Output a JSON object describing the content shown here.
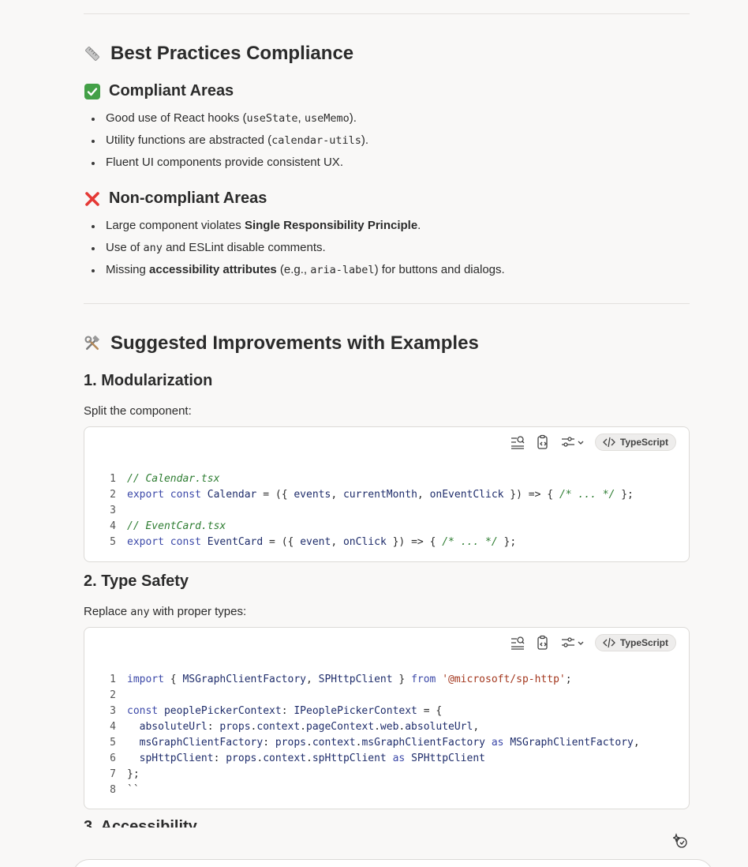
{
  "sections": {
    "best_practices": {
      "title": "Best Practices Compliance",
      "icon": "ruler-icon",
      "compliant": {
        "title": "Compliant Areas",
        "icon": "check-box-icon",
        "items": [
          {
            "pre": "Good use of React hooks (",
            "code1": "useState",
            "mid": ", ",
            "code2": "useMemo",
            "post": ")."
          },
          {
            "pre": "Utility functions are abstracted (",
            "code1": "calendar-utils",
            "post": ")."
          },
          {
            "text": "Fluent UI components provide consistent UX."
          }
        ]
      },
      "noncompliant": {
        "title": "Non-compliant Areas",
        "icon": "cross-mark-icon",
        "items": [
          {
            "pre": "Large component violates ",
            "bold": "Single Responsibility Principle",
            "post": "."
          },
          {
            "pre": "Use of ",
            "code1": "any",
            "post": " and ESLint disable comments."
          },
          {
            "pre": "Missing ",
            "bold": "accessibility attributes",
            "mid": " (e.g., ",
            "code1": "aria-label",
            "post": ") for buttons and dialogs."
          }
        ]
      }
    },
    "improvements": {
      "title": "Suggested Improvements with Examples",
      "icon": "hammer-wrench-icon",
      "sub1": {
        "title": "1. Modularization",
        "text": "Split the component:",
        "lang": "TypeScript",
        "lines": [
          {
            "n": "1",
            "tokens": [
              [
                "com",
                "// Calendar.tsx"
              ]
            ]
          },
          {
            "n": "2",
            "tokens": [
              [
                "kw",
                "export"
              ],
              [
                "p",
                " "
              ],
              [
                "kw",
                "const"
              ],
              [
                "p",
                " "
              ],
              [
                "id",
                "Calendar"
              ],
              [
                "p",
                " = ({ "
              ],
              [
                "id",
                "events"
              ],
              [
                "p",
                ", "
              ],
              [
                "id",
                "currentMonth"
              ],
              [
                "p",
                ", "
              ],
              [
                "id",
                "onEventClick"
              ],
              [
                "p",
                " }) => { "
              ],
              [
                "com",
                "/* ... */"
              ],
              [
                "p",
                " };"
              ]
            ]
          },
          {
            "n": "3",
            "tokens": []
          },
          {
            "n": "4",
            "tokens": [
              [
                "com",
                "// EventCard.tsx"
              ]
            ]
          },
          {
            "n": "5",
            "tokens": [
              [
                "kw",
                "export"
              ],
              [
                "p",
                " "
              ],
              [
                "kw",
                "const"
              ],
              [
                "p",
                " "
              ],
              [
                "id",
                "EventCard"
              ],
              [
                "p",
                " = ({ "
              ],
              [
                "id",
                "event"
              ],
              [
                "p",
                ", "
              ],
              [
                "id",
                "onClick"
              ],
              [
                "p",
                " }) => { "
              ],
              [
                "com",
                "/* ... */"
              ],
              [
                "p",
                " };"
              ]
            ]
          }
        ]
      },
      "sub2": {
        "title": "2. Type Safety",
        "text_pre": "Replace ",
        "text_code": "any",
        "text_post": " with proper types:",
        "lang": "TypeScript",
        "lines": [
          {
            "n": "1",
            "tokens": [
              [
                "kw",
                "import"
              ],
              [
                "p",
                " { "
              ],
              [
                "id",
                "MSGraphClientFactory"
              ],
              [
                "p",
                ", "
              ],
              [
                "id",
                "SPHttpClient"
              ],
              [
                "p",
                " } "
              ],
              [
                "kw",
                "from"
              ],
              [
                "p",
                " "
              ],
              [
                "str",
                "'@microsoft/sp-http'"
              ],
              [
                "p",
                ";"
              ]
            ]
          },
          {
            "n": "2",
            "tokens": []
          },
          {
            "n": "3",
            "tokens": [
              [
                "kw",
                "const"
              ],
              [
                "p",
                " "
              ],
              [
                "id",
                "peoplePickerContext"
              ],
              [
                "p",
                ": "
              ],
              [
                "id",
                "IPeoplePickerContext"
              ],
              [
                "p",
                " = {"
              ]
            ]
          },
          {
            "n": "4",
            "tokens": [
              [
                "p",
                "  "
              ],
              [
                "id",
                "absoluteUrl"
              ],
              [
                "p",
                ": "
              ],
              [
                "id",
                "props"
              ],
              [
                "p",
                "."
              ],
              [
                "id",
                "context"
              ],
              [
                "p",
                "."
              ],
              [
                "id",
                "pageContext"
              ],
              [
                "p",
                "."
              ],
              [
                "id",
                "web"
              ],
              [
                "p",
                "."
              ],
              [
                "id",
                "absoluteUrl"
              ],
              [
                "p",
                ","
              ]
            ]
          },
          {
            "n": "5",
            "tokens": [
              [
                "p",
                "  "
              ],
              [
                "id",
                "msGraphClientFactory"
              ],
              [
                "p",
                ": "
              ],
              [
                "id",
                "props"
              ],
              [
                "p",
                "."
              ],
              [
                "id",
                "context"
              ],
              [
                "p",
                "."
              ],
              [
                "id",
                "msGraphClientFactory"
              ],
              [
                "p",
                " "
              ],
              [
                "kw",
                "as"
              ],
              [
                "p",
                " "
              ],
              [
                "id",
                "MSGraphClientFactory"
              ],
              [
                "p",
                ","
              ]
            ]
          },
          {
            "n": "6",
            "tokens": [
              [
                "p",
                "  "
              ],
              [
                "id",
                "spHttpClient"
              ],
              [
                "p",
                ": "
              ],
              [
                "id",
                "props"
              ],
              [
                "p",
                "."
              ],
              [
                "id",
                "context"
              ],
              [
                "p",
                "."
              ],
              [
                "id",
                "spHttpClient"
              ],
              [
                "p",
                " "
              ],
              [
                "kw",
                "as"
              ],
              [
                "p",
                " "
              ],
              [
                "id",
                "SPHttpClient"
              ]
            ]
          },
          {
            "n": "7",
            "tokens": [
              [
                "p",
                "};"
              ]
            ]
          },
          {
            "n": "8",
            "tokens": [
              [
                "p",
                "``"
              ]
            ]
          }
        ]
      },
      "sub3_partial_title": "3. Accessibility"
    }
  },
  "colors": {
    "background": "#f9f8f7",
    "keyword": "#3b48a8",
    "comment": "#2e7d32",
    "string": "#a4381f"
  }
}
